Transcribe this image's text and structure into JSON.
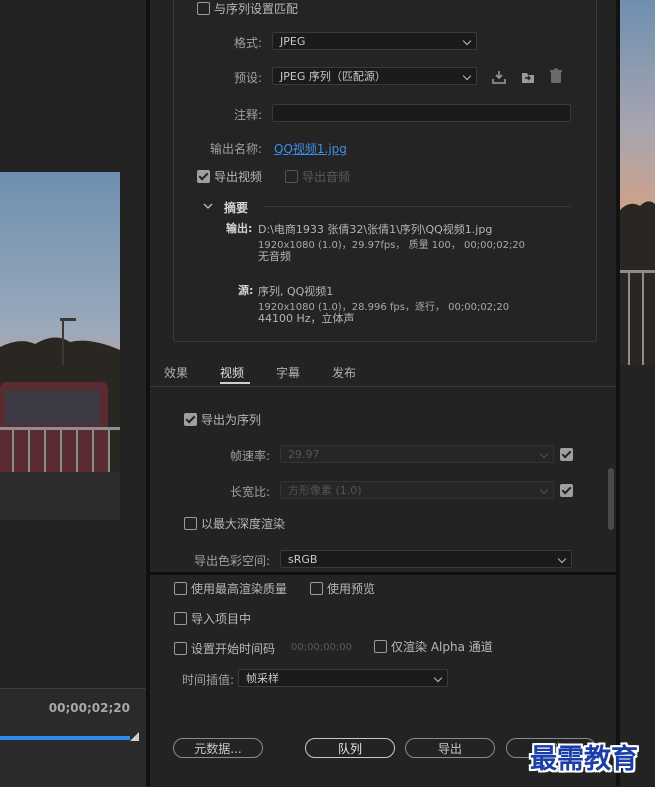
{
  "left": {
    "timecode": "00;00;02;20"
  },
  "dialog": {
    "match_sequence_label": "与序列设置匹配",
    "format": {
      "label": "格式:",
      "value": "JPEG"
    },
    "preset": {
      "label": "预设:",
      "value": "JPEG 序列（匹配源）"
    },
    "comment": {
      "label": "注释:",
      "value": ""
    },
    "output_name": {
      "label": "输出名称:",
      "value": "QQ视频1.jpg"
    },
    "export_video_label": "导出视频",
    "export_audio_label": "导出音频",
    "summary": {
      "title": "摘要",
      "output_key": "输出:",
      "output_lines": [
        "D:\\电商1933 张倩32\\张倩1\\序列\\QQ视频1.jpg",
        "1920x1080 (1.0)，29.97fps， 质量 100， 00;00;02;20",
        "无音频"
      ],
      "source_key": "源:",
      "source_lines": [
        "序列, QQ视频1",
        "1920x1080 (1.0)，28.996 fps，逐行， 00;00;02;20",
        "44100 Hz，立体声"
      ]
    },
    "tabs": [
      "效果",
      "视频",
      "字幕",
      "发布"
    ],
    "active_tab": "视频",
    "video": {
      "export_as_sequence_label": "导出为序列",
      "frame_rate": {
        "label": "帧速率:",
        "value": "29.97"
      },
      "aspect": {
        "label": "长宽比:",
        "value": "方形像素 (1.0)"
      },
      "max_depth_label": "以最大深度渲染",
      "color_space": {
        "label": "导出色彩空间:",
        "value": "sRGB"
      }
    },
    "options": {
      "max_quality_label": "使用最高渲染质量",
      "use_preview_label": "使用预览",
      "import_project_label": "导入项目中",
      "set_start_tc_label": "设置开始时间码",
      "start_tc_value": "00;00;00;00",
      "alpha_only_label": "仅渲染 Alpha 通道",
      "interp": {
        "label": "时间插值:",
        "value": "帧采样"
      }
    },
    "buttons": {
      "metadata": "元数据...",
      "queue": "队列",
      "export": "导出",
      "cancel": "取消"
    }
  },
  "watermark": "最需教育",
  "colors": {
    "accent_link": "#3d8ee8",
    "progress": "#2d8ceb",
    "watermark": "#1a3fa8"
  }
}
